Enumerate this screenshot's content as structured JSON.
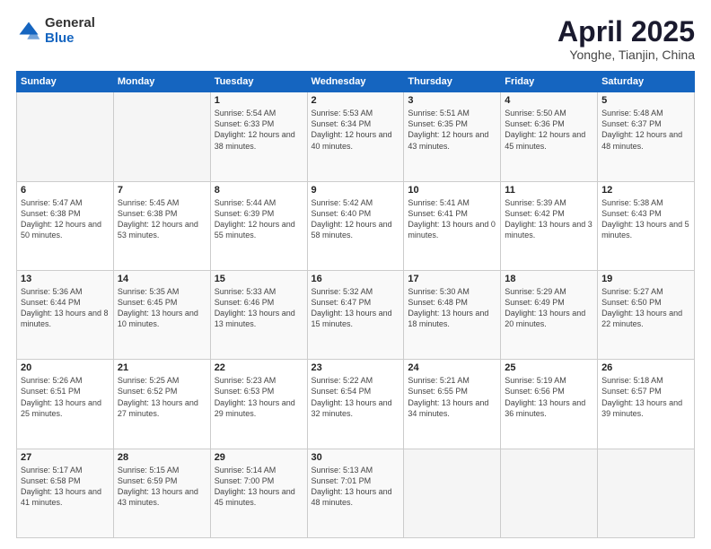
{
  "logo": {
    "general": "General",
    "blue": "Blue"
  },
  "title": "April 2025",
  "subtitle": "Yonghe, Tianjin, China",
  "weekdays": [
    "Sunday",
    "Monday",
    "Tuesday",
    "Wednesday",
    "Thursday",
    "Friday",
    "Saturday"
  ],
  "weeks": [
    [
      {
        "day": "",
        "sunrise": "",
        "sunset": "",
        "daylight": ""
      },
      {
        "day": "",
        "sunrise": "",
        "sunset": "",
        "daylight": ""
      },
      {
        "day": "1",
        "sunrise": "Sunrise: 5:54 AM",
        "sunset": "Sunset: 6:33 PM",
        "daylight": "Daylight: 12 hours and 38 minutes."
      },
      {
        "day": "2",
        "sunrise": "Sunrise: 5:53 AM",
        "sunset": "Sunset: 6:34 PM",
        "daylight": "Daylight: 12 hours and 40 minutes."
      },
      {
        "day": "3",
        "sunrise": "Sunrise: 5:51 AM",
        "sunset": "Sunset: 6:35 PM",
        "daylight": "Daylight: 12 hours and 43 minutes."
      },
      {
        "day": "4",
        "sunrise": "Sunrise: 5:50 AM",
        "sunset": "Sunset: 6:36 PM",
        "daylight": "Daylight: 12 hours and 45 minutes."
      },
      {
        "day": "5",
        "sunrise": "Sunrise: 5:48 AM",
        "sunset": "Sunset: 6:37 PM",
        "daylight": "Daylight: 12 hours and 48 minutes."
      }
    ],
    [
      {
        "day": "6",
        "sunrise": "Sunrise: 5:47 AM",
        "sunset": "Sunset: 6:38 PM",
        "daylight": "Daylight: 12 hours and 50 minutes."
      },
      {
        "day": "7",
        "sunrise": "Sunrise: 5:45 AM",
        "sunset": "Sunset: 6:38 PM",
        "daylight": "Daylight: 12 hours and 53 minutes."
      },
      {
        "day": "8",
        "sunrise": "Sunrise: 5:44 AM",
        "sunset": "Sunset: 6:39 PM",
        "daylight": "Daylight: 12 hours and 55 minutes."
      },
      {
        "day": "9",
        "sunrise": "Sunrise: 5:42 AM",
        "sunset": "Sunset: 6:40 PM",
        "daylight": "Daylight: 12 hours and 58 minutes."
      },
      {
        "day": "10",
        "sunrise": "Sunrise: 5:41 AM",
        "sunset": "Sunset: 6:41 PM",
        "daylight": "Daylight: 13 hours and 0 minutes."
      },
      {
        "day": "11",
        "sunrise": "Sunrise: 5:39 AM",
        "sunset": "Sunset: 6:42 PM",
        "daylight": "Daylight: 13 hours and 3 minutes."
      },
      {
        "day": "12",
        "sunrise": "Sunrise: 5:38 AM",
        "sunset": "Sunset: 6:43 PM",
        "daylight": "Daylight: 13 hours and 5 minutes."
      }
    ],
    [
      {
        "day": "13",
        "sunrise": "Sunrise: 5:36 AM",
        "sunset": "Sunset: 6:44 PM",
        "daylight": "Daylight: 13 hours and 8 minutes."
      },
      {
        "day": "14",
        "sunrise": "Sunrise: 5:35 AM",
        "sunset": "Sunset: 6:45 PM",
        "daylight": "Daylight: 13 hours and 10 minutes."
      },
      {
        "day": "15",
        "sunrise": "Sunrise: 5:33 AM",
        "sunset": "Sunset: 6:46 PM",
        "daylight": "Daylight: 13 hours and 13 minutes."
      },
      {
        "day": "16",
        "sunrise": "Sunrise: 5:32 AM",
        "sunset": "Sunset: 6:47 PM",
        "daylight": "Daylight: 13 hours and 15 minutes."
      },
      {
        "day": "17",
        "sunrise": "Sunrise: 5:30 AM",
        "sunset": "Sunset: 6:48 PM",
        "daylight": "Daylight: 13 hours and 18 minutes."
      },
      {
        "day": "18",
        "sunrise": "Sunrise: 5:29 AM",
        "sunset": "Sunset: 6:49 PM",
        "daylight": "Daylight: 13 hours and 20 minutes."
      },
      {
        "day": "19",
        "sunrise": "Sunrise: 5:27 AM",
        "sunset": "Sunset: 6:50 PM",
        "daylight": "Daylight: 13 hours and 22 minutes."
      }
    ],
    [
      {
        "day": "20",
        "sunrise": "Sunrise: 5:26 AM",
        "sunset": "Sunset: 6:51 PM",
        "daylight": "Daylight: 13 hours and 25 minutes."
      },
      {
        "day": "21",
        "sunrise": "Sunrise: 5:25 AM",
        "sunset": "Sunset: 6:52 PM",
        "daylight": "Daylight: 13 hours and 27 minutes."
      },
      {
        "day": "22",
        "sunrise": "Sunrise: 5:23 AM",
        "sunset": "Sunset: 6:53 PM",
        "daylight": "Daylight: 13 hours and 29 minutes."
      },
      {
        "day": "23",
        "sunrise": "Sunrise: 5:22 AM",
        "sunset": "Sunset: 6:54 PM",
        "daylight": "Daylight: 13 hours and 32 minutes."
      },
      {
        "day": "24",
        "sunrise": "Sunrise: 5:21 AM",
        "sunset": "Sunset: 6:55 PM",
        "daylight": "Daylight: 13 hours and 34 minutes."
      },
      {
        "day": "25",
        "sunrise": "Sunrise: 5:19 AM",
        "sunset": "Sunset: 6:56 PM",
        "daylight": "Daylight: 13 hours and 36 minutes."
      },
      {
        "day": "26",
        "sunrise": "Sunrise: 5:18 AM",
        "sunset": "Sunset: 6:57 PM",
        "daylight": "Daylight: 13 hours and 39 minutes."
      }
    ],
    [
      {
        "day": "27",
        "sunrise": "Sunrise: 5:17 AM",
        "sunset": "Sunset: 6:58 PM",
        "daylight": "Daylight: 13 hours and 41 minutes."
      },
      {
        "day": "28",
        "sunrise": "Sunrise: 5:15 AM",
        "sunset": "Sunset: 6:59 PM",
        "daylight": "Daylight: 13 hours and 43 minutes."
      },
      {
        "day": "29",
        "sunrise": "Sunrise: 5:14 AM",
        "sunset": "Sunset: 7:00 PM",
        "daylight": "Daylight: 13 hours and 45 minutes."
      },
      {
        "day": "30",
        "sunrise": "Sunrise: 5:13 AM",
        "sunset": "Sunset: 7:01 PM",
        "daylight": "Daylight: 13 hours and 48 minutes."
      },
      {
        "day": "",
        "sunrise": "",
        "sunset": "",
        "daylight": ""
      },
      {
        "day": "",
        "sunrise": "",
        "sunset": "",
        "daylight": ""
      },
      {
        "day": "",
        "sunrise": "",
        "sunset": "",
        "daylight": ""
      }
    ]
  ]
}
